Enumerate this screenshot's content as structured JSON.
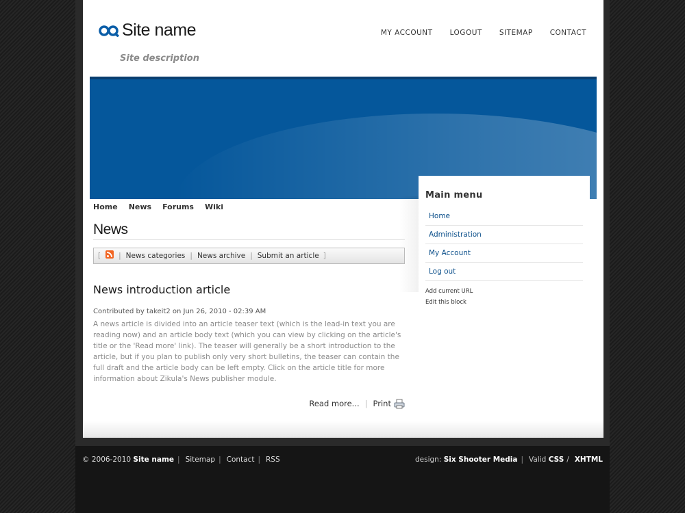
{
  "header": {
    "site_name": "Site name",
    "site_description": "Site description",
    "top_nav": [
      "MY ACCOUNT",
      "LOGOUT",
      "SITEMAP",
      "CONTACT"
    ]
  },
  "content_nav": [
    "Home",
    "News",
    "Forums",
    "Wiki"
  ],
  "section_title": "News",
  "news_bar": {
    "open_bracket": "[",
    "close_bracket": "]",
    "links": [
      "News categories",
      "News archive",
      "Submit an article"
    ]
  },
  "article": {
    "title": "News introduction article",
    "meta": "Contributed by takeit2 on Jun 26, 2010 - 02:39 AM",
    "body": "A news article is divided into an article teaser text (which is the lead-in text you are reading now) and an article body text (which you can view by clicking on the article's title or the 'Read more' link). The teaser will generally be a short introduction to the article, but if you plan to publish only very short bulletins, the teaser can contain the full draft and the article body can be left empty. Click on the article title for more information about Zikula's News publisher module.",
    "read_more": "Read more...",
    "print": "Print"
  },
  "sidebar": {
    "title": "Main menu",
    "items": [
      "Home",
      "Administration",
      "My Account",
      "Log out"
    ],
    "add_url": "Add current URL",
    "edit_block": "Edit this block"
  },
  "footer": {
    "copyright": "© 2006-2010",
    "site_name": "Site name",
    "links": [
      "Sitemap",
      "Contact",
      "RSS"
    ],
    "design_label": "design:",
    "designer": "Six Shooter Media",
    "valid": "Valid",
    "css": "CSS",
    "slash": "/",
    "xhtml": "XHTML"
  },
  "colors": {
    "banner_blue": "#05579b",
    "link_blue": "#0b4f8a",
    "rss_orange": "#f26522"
  }
}
